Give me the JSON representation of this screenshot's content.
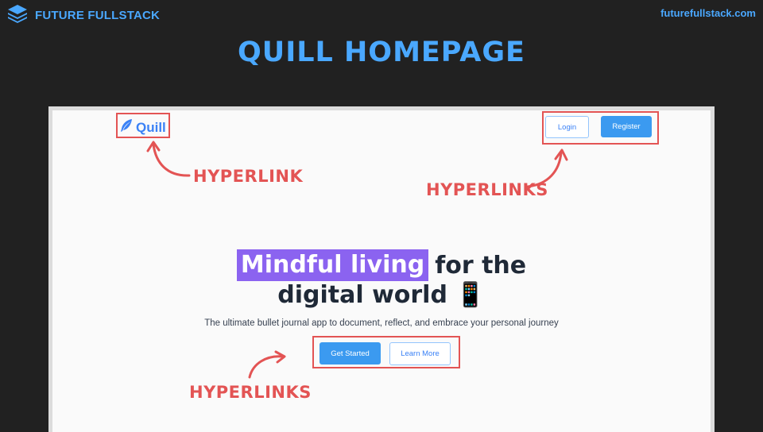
{
  "brand": {
    "name": "FUTURE FULLSTACK",
    "url": "futurefullstack.com",
    "color": "#4aa8ff"
  },
  "slide_title": "QUILL HOMEPAGE",
  "app": {
    "logo_text": "Quill",
    "login_label": "Login",
    "register_label": "Register",
    "hero_highlight": "Mindful living",
    "hero_rest_line1": "for the",
    "hero_line2": "digital world 📱",
    "subtitle": "The ultimate bullet journal app to document, reflect, and embrace your personal journey",
    "get_started_label": "Get Started",
    "learn_more_label": "Learn More",
    "accent_color": "#3b9af0",
    "highlight_color": "#8b63f0"
  },
  "annotations": {
    "logo_note": "HYPERLINK",
    "nav_note": "HYPERLINKS",
    "cta_note": "HYPERLINKS",
    "color": "#e35454"
  },
  "icons": [
    "layers-stack-icon",
    "quill-feather-icon",
    "mobile-phone-emoji"
  ]
}
